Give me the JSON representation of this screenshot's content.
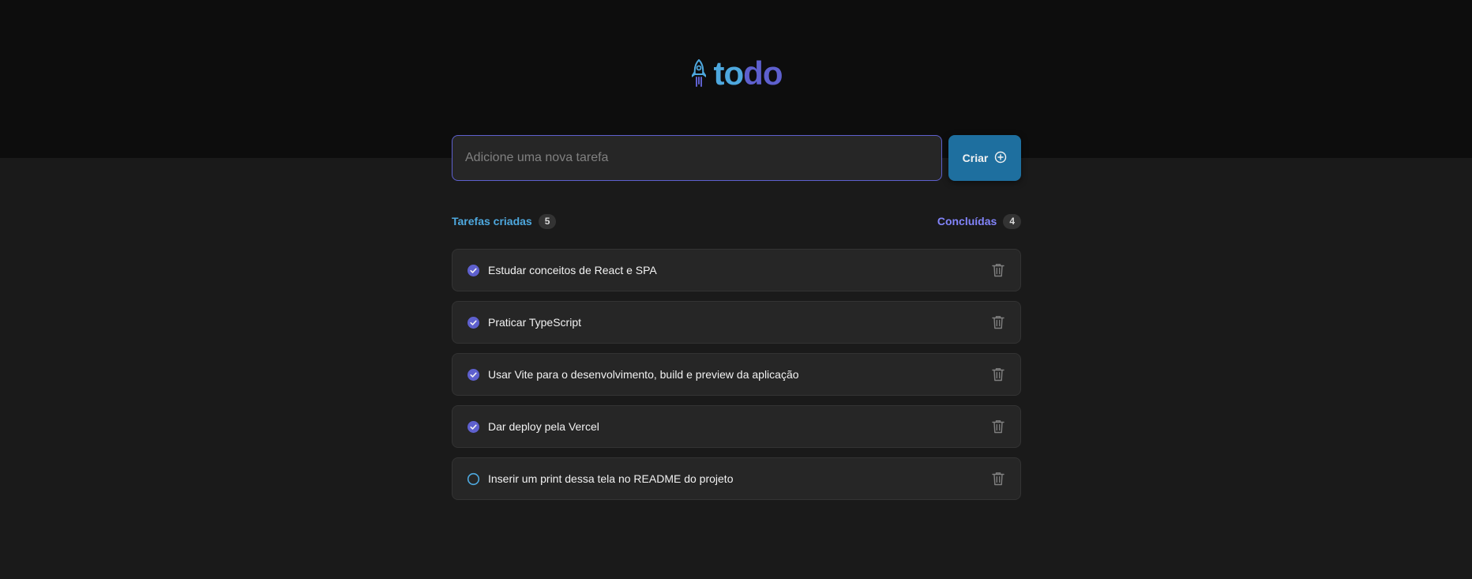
{
  "app": {
    "title_part1": "to",
    "title_part2": "do",
    "logo_icon": "rocket-icon"
  },
  "colors": {
    "header_bg": "#0d0d0d",
    "page_bg": "#1a1a1a",
    "blue": "#4ea8de",
    "purple": "#5e60ce",
    "purple_light": "#8284fa",
    "button_bg": "#1e6f9f"
  },
  "new_task": {
    "placeholder": "Adicione uma nova tarefa",
    "value": "",
    "create_label": "Criar",
    "create_icon": "plus-circle-icon"
  },
  "stats": {
    "created_label": "Tarefas criadas",
    "created_count": "5",
    "done_label": "Concluídas",
    "done_count": "4"
  },
  "tasks": [
    {
      "text": "Estudar conceitos de React e SPA",
      "done": true
    },
    {
      "text": "Praticar TypeScript",
      "done": true
    },
    {
      "text": "Usar Vite para o desenvolvimento, build e preview da aplicação",
      "done": true
    },
    {
      "text": "Dar deploy pela Vercel",
      "done": true
    },
    {
      "text": "Inserir um print dessa tela no README do projeto",
      "done": false
    }
  ]
}
